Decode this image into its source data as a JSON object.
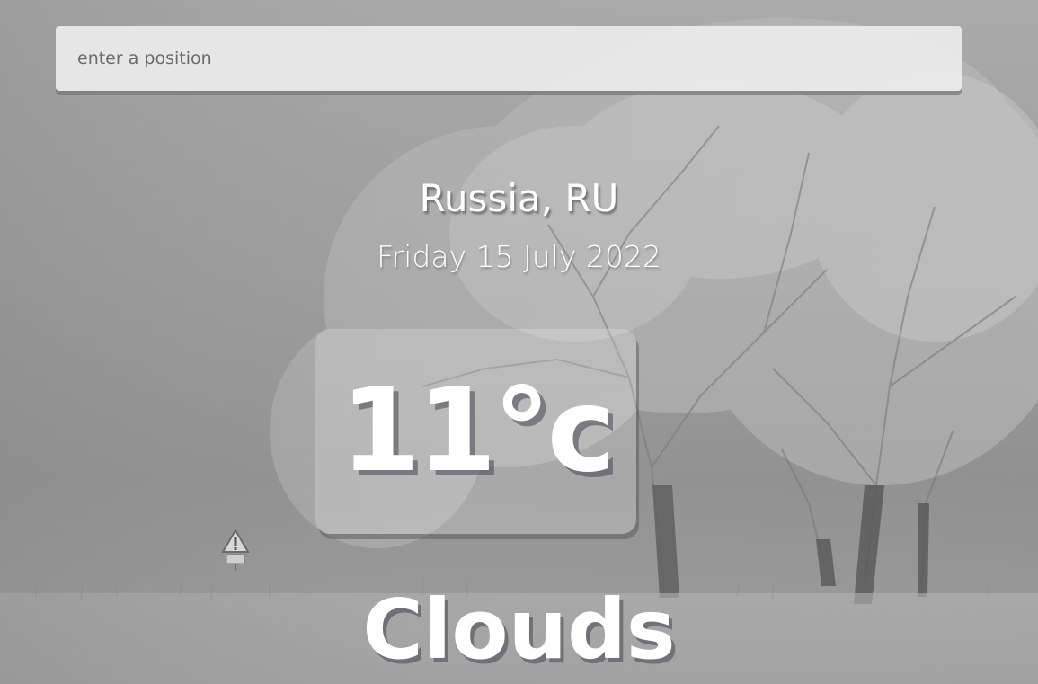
{
  "search": {
    "placeholder": "enter a position",
    "value": ""
  },
  "weather": {
    "location": "Russia, RU",
    "date": "Friday 15 July 2022",
    "temperature": "11°c",
    "condition": "Clouds"
  },
  "background": {
    "description_icon": "frosty-trees-background",
    "sign_icon": "warning-road-sign-icon"
  }
}
